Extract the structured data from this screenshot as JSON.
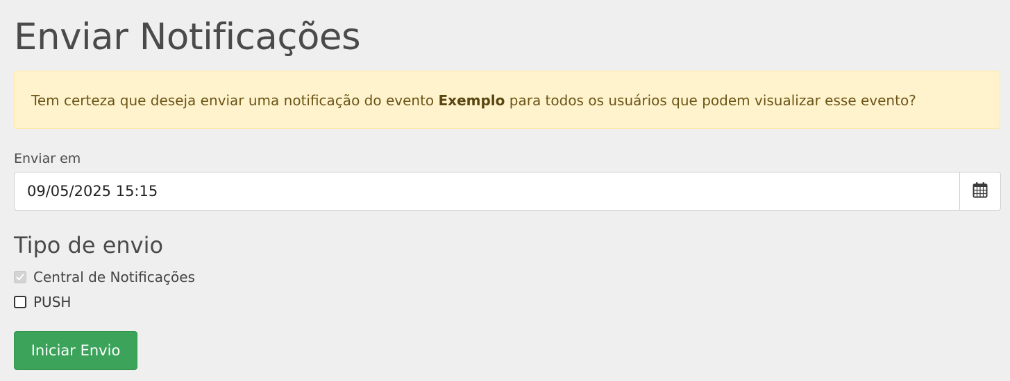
{
  "page": {
    "title": "Enviar Notificações"
  },
  "alert": {
    "text_before": "Tem certeza que deseja enviar uma notificação do evento ",
    "event_name": "Exemplo",
    "text_after": " para todos os usuários que podem visualizar esse evento?"
  },
  "schedule": {
    "label": "Enviar em",
    "value": "09/05/2025 15:15",
    "icon": "calendar-icon"
  },
  "send_type": {
    "title": "Tipo de envio",
    "options": [
      {
        "label": "Central de Notificações",
        "checked": true,
        "disabled": true
      },
      {
        "label": "PUSH",
        "checked": false,
        "disabled": false
      }
    ]
  },
  "actions": {
    "submit_label": "Iniciar Envio",
    "submit_color": "#3ba35a"
  },
  "colors": {
    "alert_background": "#fff3cd",
    "alert_text": "#6b5516"
  }
}
